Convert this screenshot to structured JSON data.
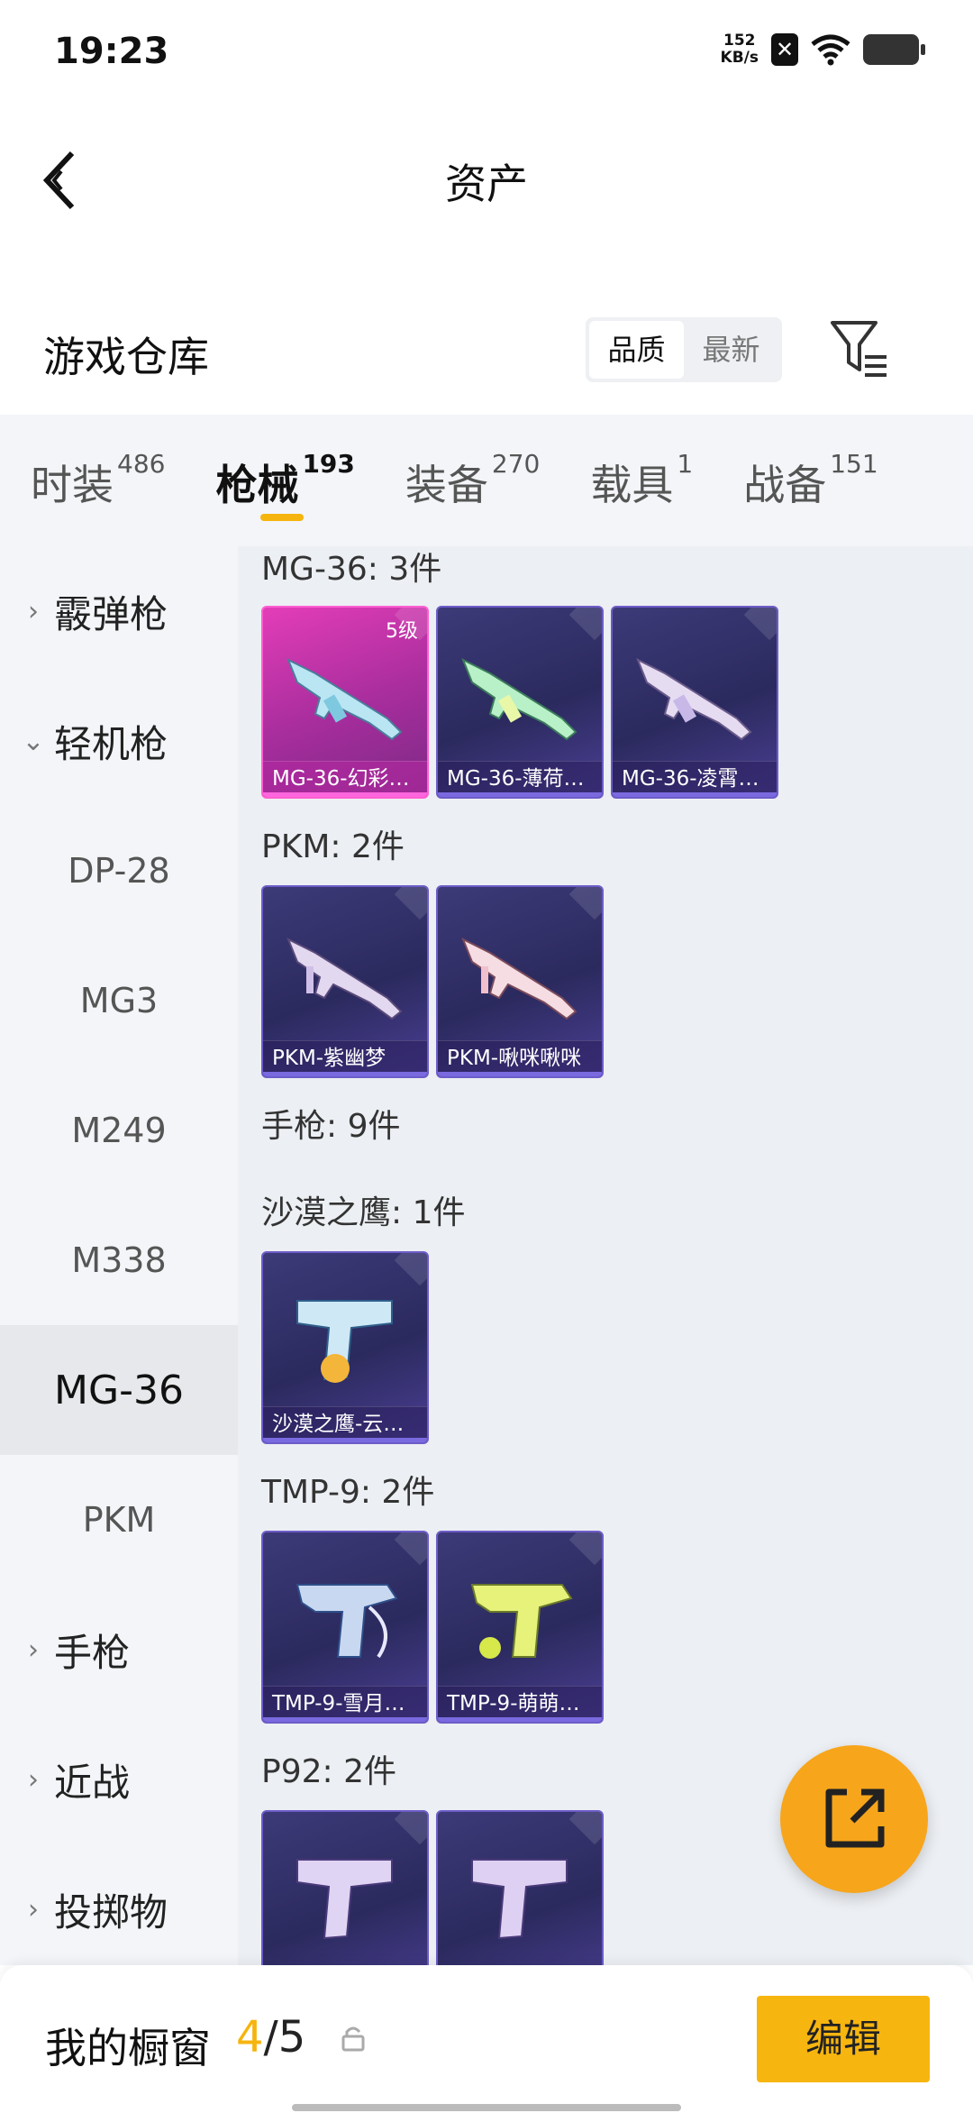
{
  "status": {
    "time": "19:23",
    "net_speed_value": "152",
    "net_speed_unit": "KB/s"
  },
  "header": {
    "title": "资产"
  },
  "section": {
    "title": "游戏仓库",
    "sort_options": [
      "品质",
      "最新"
    ],
    "sort_selected": "品质"
  },
  "tabs": [
    {
      "label": "时装",
      "count": "486"
    },
    {
      "label": "枪械",
      "count": "193",
      "active": true
    },
    {
      "label": "装备",
      "count": "270"
    },
    {
      "label": "载具",
      "count": "1"
    },
    {
      "label": "战备",
      "count": "151"
    }
  ],
  "sidebar": {
    "items": [
      {
        "label": "霰弹枪",
        "type": "group",
        "expanded": false
      },
      {
        "label": "轻机枪",
        "type": "group",
        "expanded": true
      },
      {
        "label": "DP-28",
        "type": "sub"
      },
      {
        "label": "MG3",
        "type": "sub"
      },
      {
        "label": "M249",
        "type": "sub"
      },
      {
        "label": "M338",
        "type": "sub"
      },
      {
        "label": "MG-36",
        "type": "sub",
        "selected": true
      },
      {
        "label": "PKM",
        "type": "sub"
      },
      {
        "label": "手枪",
        "type": "group",
        "expanded": false
      },
      {
        "label": "近战",
        "type": "group",
        "expanded": false
      },
      {
        "label": "投掷物",
        "type": "group",
        "expanded": false
      }
    ]
  },
  "content": {
    "groups": [
      {
        "title": "MG-36: 3件",
        "items": [
          {
            "name": "MG-36-幻彩…",
            "level": "5级",
            "rarity": "pink",
            "icon": "rifle-icon"
          },
          {
            "name": "MG-36-薄荷…",
            "rarity": "purple",
            "icon": "rifle-icon"
          },
          {
            "name": "MG-36-凌霄…",
            "rarity": "purple",
            "icon": "rifle-icon"
          }
        ]
      },
      {
        "title": "PKM: 2件",
        "items": [
          {
            "name": "PKM-紫幽梦",
            "rarity": "purple",
            "icon": "rifle-icon"
          },
          {
            "name": "PKM-啾咪啾咪",
            "rarity": "purple",
            "icon": "rifle-icon"
          }
        ]
      },
      {
        "title": "手枪: 9件",
        "items": []
      },
      {
        "title": "沙漠之鹰: 1件",
        "items": [
          {
            "name": "沙漠之鹰-云…",
            "rarity": "purple",
            "icon": "pistol-icon"
          }
        ]
      },
      {
        "title": "TMP-9: 2件",
        "items": [
          {
            "name": "TMP-9-雪月…",
            "rarity": "purple",
            "icon": "smg-icon"
          },
          {
            "name": "TMP-9-萌萌…",
            "rarity": "purple",
            "icon": "smg-icon"
          }
        ]
      },
      {
        "title": "P92: 2件",
        "items": [
          {
            "name": "",
            "rarity": "purple",
            "icon": "pistol-icon"
          },
          {
            "name": "",
            "rarity": "purple",
            "icon": "pistol-icon"
          }
        ]
      }
    ]
  },
  "fab": {
    "icon": "share-icon"
  },
  "bottom": {
    "showcase_label": "我的橱窗",
    "showcase_current": "4",
    "showcase_sep": "/",
    "showcase_total": "5",
    "edit_label": "编辑"
  },
  "colors": {
    "accent": "#f6b40e",
    "fab": "#f7a51b",
    "rarity_purple": "#3c3a78",
    "rarity_pink": "#e33db8"
  }
}
